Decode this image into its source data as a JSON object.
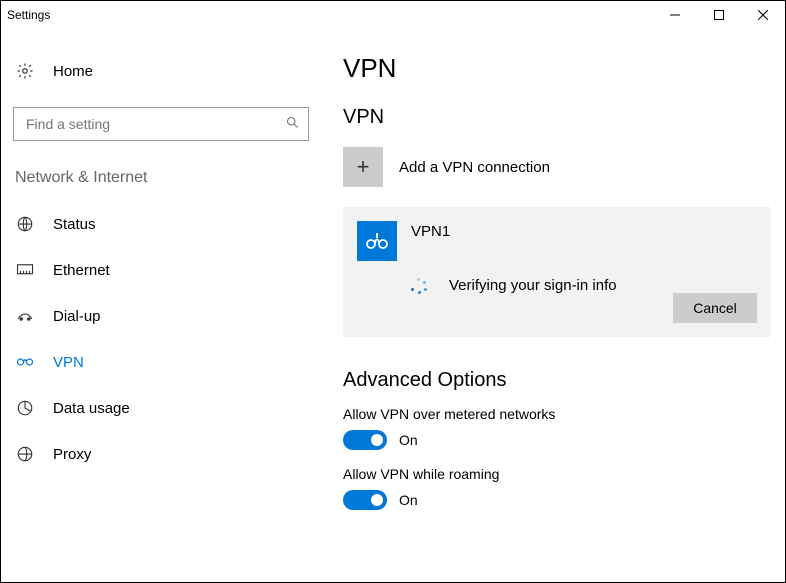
{
  "window": {
    "title": "Settings"
  },
  "sidebar": {
    "home_label": "Home",
    "search_placeholder": "Find a setting",
    "category_header": "Network & Internet",
    "items": [
      {
        "icon": "status-icon",
        "label": "Status"
      },
      {
        "icon": "ethernet-icon",
        "label": "Ethernet"
      },
      {
        "icon": "dialup-icon",
        "label": "Dial-up"
      },
      {
        "icon": "vpn-icon",
        "label": "VPN"
      },
      {
        "icon": "datausage-icon",
        "label": "Data usage"
      },
      {
        "icon": "proxy-icon",
        "label": "Proxy"
      }
    ]
  },
  "main": {
    "page_title": "VPN",
    "section_title": "VPN",
    "add_label": "Add a VPN connection",
    "connection": {
      "name": "VPN1",
      "status": "Verifying your sign-in info",
      "cancel_label": "Cancel"
    },
    "advanced_title": "Advanced Options",
    "option1_label": "Allow VPN over metered networks",
    "option1_state": "On",
    "option2_label": "Allow VPN while roaming",
    "option2_state": "On"
  }
}
